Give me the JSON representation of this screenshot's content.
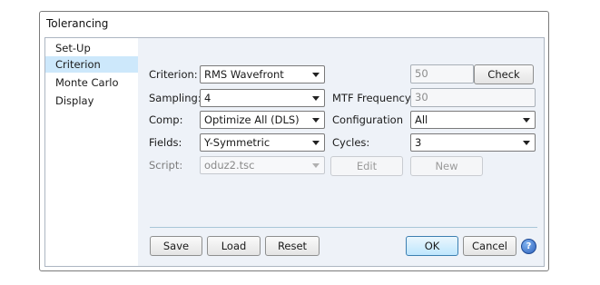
{
  "window": {
    "title": "Tolerancing"
  },
  "sidebar": {
    "items": [
      {
        "label": "Set-Up"
      },
      {
        "label": "Criterion",
        "selected": true
      },
      {
        "label": "Monte Carlo"
      },
      {
        "label": "Display"
      }
    ]
  },
  "criterion": {
    "label": "Criterion:",
    "value": "RMS Wavefront",
    "number": "50",
    "check_label": "Check"
  },
  "sampling": {
    "label": "Sampling:",
    "value": "4"
  },
  "mtf_frequency": {
    "label": "MTF Frequency:",
    "value": "30"
  },
  "comp": {
    "label": "Comp:",
    "value": "Optimize All (DLS)"
  },
  "configuration": {
    "label": "Configuration",
    "value": "All"
  },
  "fields": {
    "label": "Fields:",
    "value": "Y-Symmetric"
  },
  "cycles": {
    "label": "Cycles:",
    "value": "3"
  },
  "script": {
    "label": "Script:",
    "value": "oduz2.tsc",
    "edit_label": "Edit",
    "new_label": "New"
  },
  "footer": {
    "save_label": "Save",
    "load_label": "Load",
    "reset_label": "Reset",
    "ok_label": "OK",
    "cancel_label": "Cancel",
    "help_glyph": "?"
  },
  "colors": {
    "selected_item": "#cde8fb",
    "panel_bg": "#eef2f8",
    "help_icon": "#2f63bd"
  }
}
